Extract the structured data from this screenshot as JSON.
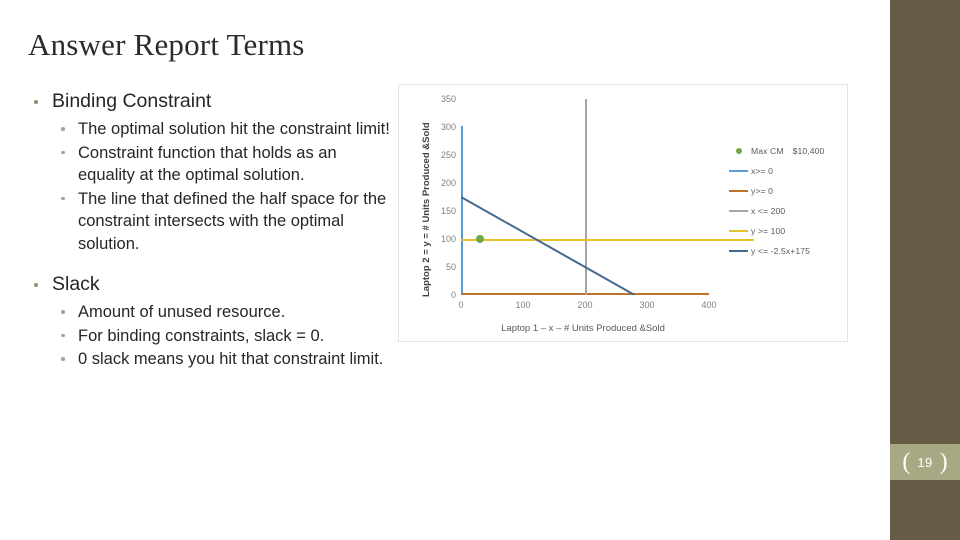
{
  "slide": {
    "title": "Answer Report Terms",
    "page_number": "19",
    "accent_color": "#665c46",
    "band_color": "#a9a885",
    "bullet_color": "#8e8c73"
  },
  "content": {
    "groups": [
      {
        "heading": "Binding Constraint",
        "items": [
          "The optimal solution hit the constraint limit!",
          "Constraint function that holds as an equality at the optimal solution.",
          "The line that defined the half space for the constraint intersects with the optimal solution."
        ]
      },
      {
        "heading": "Slack",
        "items": [
          "Amount of unused resource.",
          "For binding constraints, slack = 0.",
          "0 slack means you hit that constraint limit."
        ]
      }
    ]
  },
  "chart_data": {
    "type": "line",
    "title": "",
    "xlabel": "Laptop 1 – x – # Units Produced &Sold",
    "ylabel": "Laptop 2 = y = # Units Produced &Sold",
    "xlim": [
      0,
      400
    ],
    "ylim": [
      0,
      350
    ],
    "xticks": [
      "0",
      "100",
      "200",
      "300",
      "400"
    ],
    "yticks": [
      "0",
      "50",
      "100",
      "150",
      "200",
      "250",
      "300",
      "350"
    ],
    "grid": false,
    "legend_position": "right",
    "series": [
      {
        "name": "Max CM",
        "label": "Max CM",
        "value_label": "$10,400",
        "type": "scatter",
        "color": "#70a845",
        "points": [
          {
            "x": 30,
            "y": 100
          }
        ]
      },
      {
        "name": "x>= 0",
        "label": "x>= 0",
        "type": "line",
        "color": "#5b9bd5",
        "points": [
          {
            "x": 0,
            "y": 0
          },
          {
            "x": 0,
            "y": 300
          }
        ]
      },
      {
        "name": "y>= 0",
        "label": "y>= 0",
        "type": "line",
        "color": "#c0722f",
        "points": [
          {
            "x": 0,
            "y": 0
          },
          {
            "x": 400,
            "y": 0
          }
        ]
      },
      {
        "name": "x <= 200",
        "label": "x <=  200",
        "type": "line",
        "color": "#a5a5a5",
        "points": [
          {
            "x": 200,
            "y": 0
          },
          {
            "x": 200,
            "y": 350
          }
        ]
      },
      {
        "name": "y >= 100",
        "label": "y >=  100",
        "type": "line",
        "color": "#e5c12d",
        "points": [
          {
            "x": 0,
            "y": 100
          },
          {
            "x": 400,
            "y": 100
          }
        ]
      },
      {
        "name": "y <= -2.5x+175",
        "label": "y <=  -2.5x+175",
        "type": "line",
        "color": "#44698f",
        "points": [
          {
            "x": 0,
            "y": 175
          },
          {
            "x": 280,
            "y": 0
          }
        ]
      }
    ]
  }
}
